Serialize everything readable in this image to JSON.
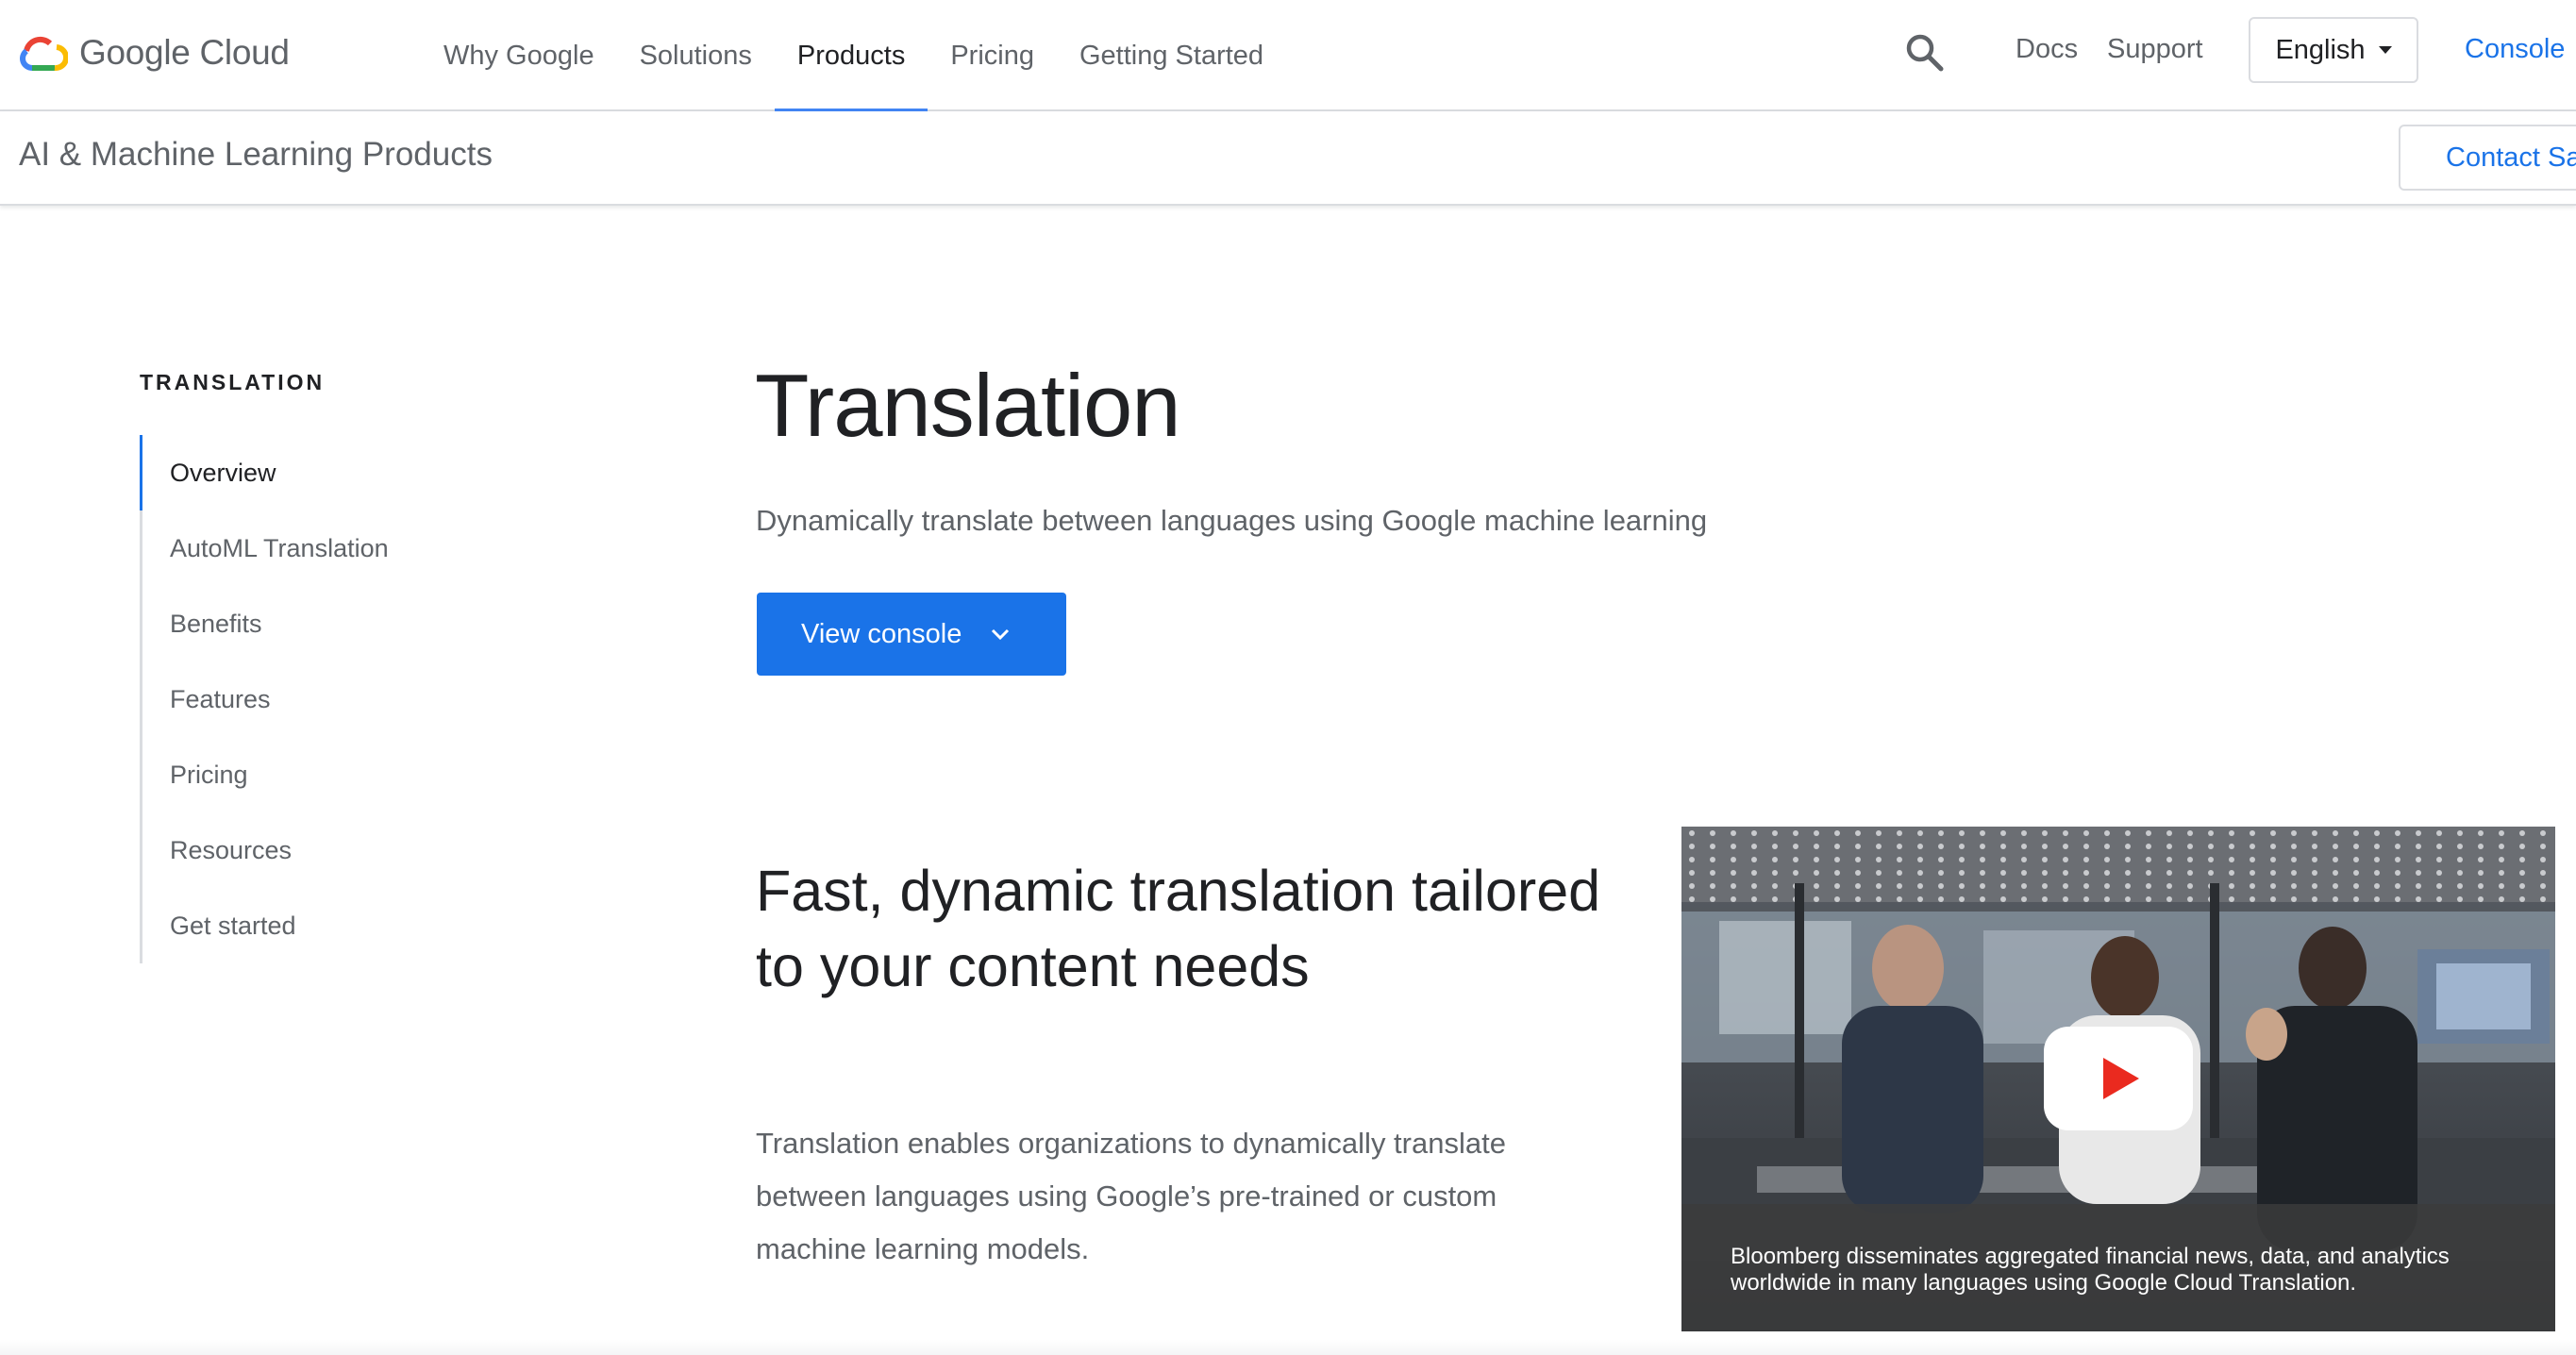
{
  "header": {
    "logo_text": "Google Cloud",
    "nav": [
      {
        "label": "Why Google",
        "active": false
      },
      {
        "label": "Solutions",
        "active": false
      },
      {
        "label": "Products",
        "active": true
      },
      {
        "label": "Pricing",
        "active": false
      },
      {
        "label": "Getting Started",
        "active": false
      }
    ],
    "search_icon": "search-icon",
    "docs_label": "Docs",
    "support_label": "Support",
    "language": "English",
    "console_label": "Console",
    "accent_color": "#1a73e8"
  },
  "subbar": {
    "title": "AI & Machine Learning Products",
    "contact_label": "Contact Sa"
  },
  "sidenav": {
    "heading": "TRANSLATION",
    "items": [
      {
        "label": "Overview",
        "active": true
      },
      {
        "label": "AutoML Translation",
        "active": false
      },
      {
        "label": "Benefits",
        "active": false
      },
      {
        "label": "Features",
        "active": false
      },
      {
        "label": "Pricing",
        "active": false
      },
      {
        "label": "Resources",
        "active": false
      },
      {
        "label": "Get started",
        "active": false
      }
    ]
  },
  "hero": {
    "title": "Translation",
    "subtitle": "Dynamically translate between languages using Google machine learning",
    "cta_label": "View console"
  },
  "feature": {
    "title": "Fast, dynamic translation tailored to your content needs",
    "body": "Translation enables organizations to dynamically translate between languages using Google’s pre-trained or custom machine learning models."
  },
  "video": {
    "caption": "Bloomberg disseminates aggregated financial news, data, and analytics worldwide in many languages using Google Cloud Translation.",
    "play_icon": "youtube-play-icon"
  }
}
